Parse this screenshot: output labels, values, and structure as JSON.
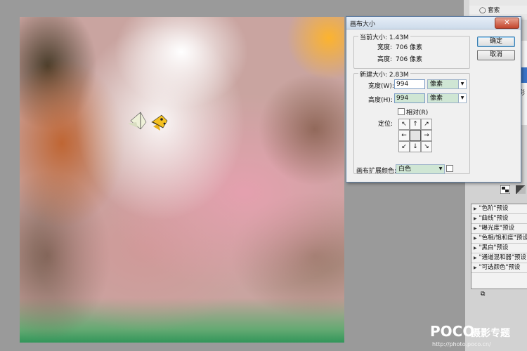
{
  "dialog": {
    "title": "画布大小",
    "close_label": "✕",
    "current_size": {
      "legend": "当前大小: 1.43M",
      "width_label": "宽度:",
      "width_value": "706 像素",
      "height_label": "高度:",
      "height_value": "706 像素"
    },
    "new_size": {
      "legend": "新建大小: 2.83M",
      "width_label": "宽度(W):",
      "width_value": "994",
      "width_unit": "像素",
      "height_label": "高度(H):",
      "height_value": "994",
      "height_unit": "像素",
      "relative_label": "相对(R)",
      "anchor_label": "定位:"
    },
    "extension_color_label": "画布扩展颜色:",
    "extension_color_value": "白色",
    "ok_label": "确定",
    "cancel_label": "取消"
  },
  "right_panel": {
    "item_label": "套索",
    "side_text": "彩",
    "presets": [
      "\"色阶\"预设",
      "\"曲线\"预设",
      "\"曝光度\"预设",
      "\"色相/饱和度\"预设",
      "\"黑白\"预设",
      "\"通道混和器\"预设",
      "\"可选颜色\"预设"
    ]
  },
  "watermark": {
    "logo": "POCO",
    "title": "摄影专题",
    "url": "http://photo.poco.cn/"
  }
}
